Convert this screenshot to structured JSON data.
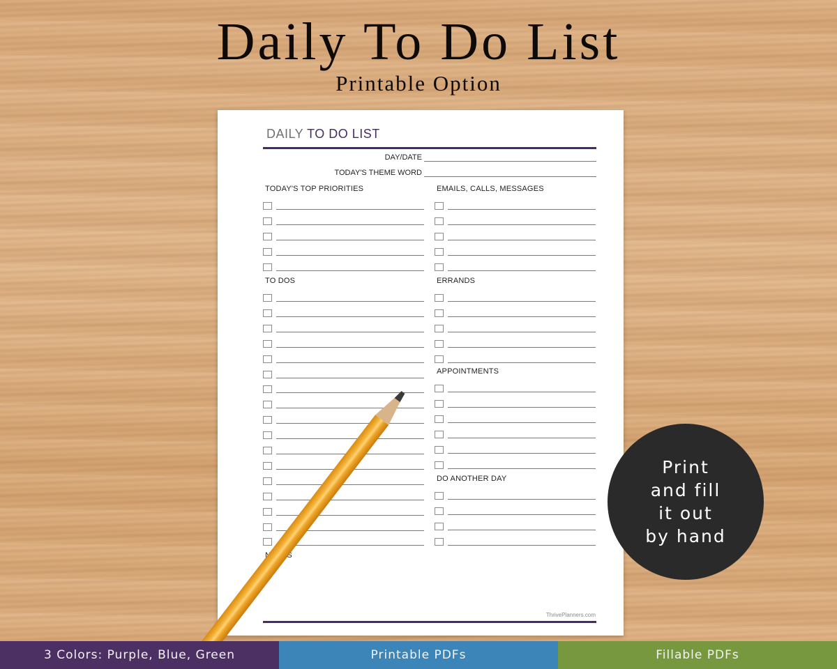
{
  "header": {
    "title": "Daily To Do List",
    "subtitle": "Printable Option"
  },
  "sheet": {
    "title_part1": "DAILY",
    "title_part2": "TO DO LIST",
    "fields": [
      {
        "label": "DAY/DATE"
      },
      {
        "label": "TODAY'S THEME WORD"
      }
    ],
    "sections": {
      "top_priorities": {
        "label": "TODAY'S TOP PRIORITIES",
        "rows": 5
      },
      "emails_calls": {
        "label": "EMAILS, CALLS, MESSAGES",
        "rows": 5
      },
      "to_dos": {
        "label": "TO DOS",
        "rows": 17
      },
      "errands": {
        "label": "ERRANDS",
        "rows": 5
      },
      "appointments": {
        "label": "APPOINTMENTS",
        "rows": 6
      },
      "do_another_day": {
        "label": "DO ANOTHER DAY",
        "rows": 4
      },
      "notes": {
        "label": "NOTES"
      }
    },
    "footer_url": "ThrivePlanners.com",
    "accent_color": "#4a2a64"
  },
  "badge": {
    "lines": [
      "Print",
      "and fill",
      "it out",
      "by hand"
    ]
  },
  "bottom_bar": [
    {
      "label": "3 Colors: Purple, Blue, Green",
      "color": "#4c2f63"
    },
    {
      "label": "Printable PDFs",
      "color": "#3b85b9"
    },
    {
      "label": "Fillable PDFs",
      "color": "#77983f"
    }
  ]
}
